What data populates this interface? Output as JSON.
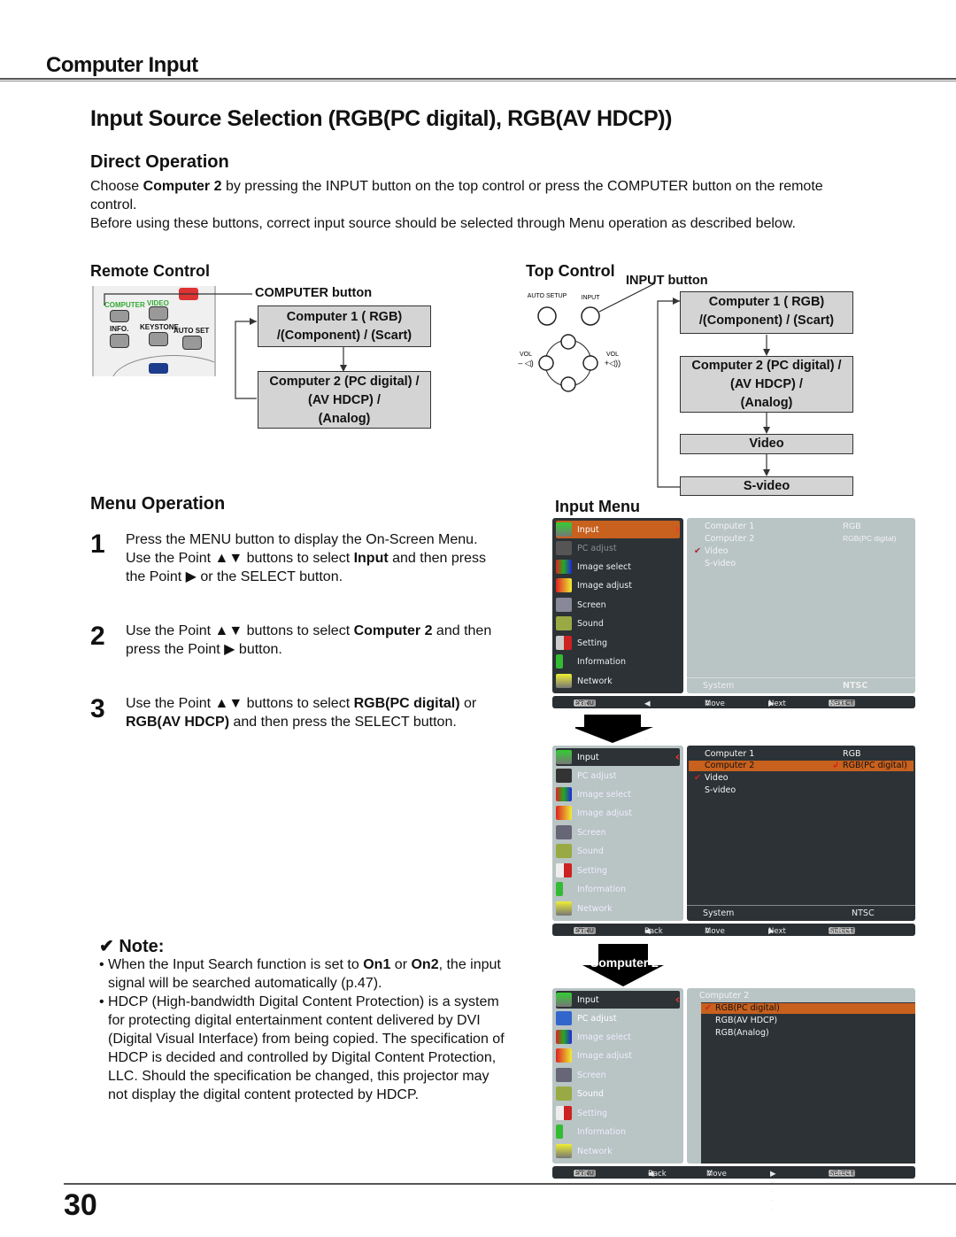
{
  "section_title": "Computer Input",
  "page_title": "Input Source Selection (RGB(PC digital), RGB(AV HDCP))",
  "direct_operation": {
    "heading": "Direct Operation",
    "p1_pre": "Choose ",
    "p1_bold": "Computer 2",
    "p1_post": " by pressing the INPUT button on the top control or press the COMPUTER button on the remote control.",
    "p2": "Before using these buttons, correct input source should be selected through Menu operation as described below."
  },
  "remote_control": {
    "heading": "Remote Control",
    "callout": "COMPUTER button",
    "remote_labels": {
      "computer": "COMPUTER",
      "video": "VIDEO",
      "info": "INFO.",
      "keystone": "KEYSTONE",
      "auto_set": "AUTO SET"
    },
    "flow": [
      [
        "Computer 1 ( RGB)",
        "/(Component) / (Scart)"
      ],
      [
        "Computer 2 (PC digital) /",
        "(AV HDCP) /",
        "(Analog)"
      ]
    ]
  },
  "top_control": {
    "heading": "Top Control",
    "callout": "INPUT button",
    "panel_labels": {
      "auto_setup": "AUTO SETUP",
      "input": "INPUT",
      "vol_minus": "VOL",
      "vol_plus": "VOL"
    },
    "flow": [
      [
        "Computer 1 ( RGB)",
        "/(Component) / (Scart)"
      ],
      [
        "Computer 2 (PC digital) /",
        "(AV HDCP) /",
        "(Analog)"
      ],
      [
        "Video"
      ],
      [
        "S-video"
      ]
    ]
  },
  "menu_operation": {
    "heading": "Menu Operation",
    "steps": [
      {
        "num": "1",
        "a": "Press the MENU button to display the On-Screen Menu. Use the Point ▲▼ buttons to select ",
        "b": "Input",
        "c": " and then press the Point ▶ or the SELECT button."
      },
      {
        "num": "2",
        "a": "Use the Point ▲▼ buttons to select ",
        "b": "Computer 2",
        "c": " and then press the Point ▶ button."
      },
      {
        "num": "3",
        "a": "Use the Point ▲▼ buttons to select ",
        "b": "RGB(PC digital)",
        "c": " or ",
        "d": "RGB(AV HDCP)",
        "e": " and then press the SELECT button."
      }
    ]
  },
  "note": {
    "heading": "✔ Note:",
    "items": [
      {
        "a": "When the Input Search function is set to ",
        "b": "On1",
        "c": " or ",
        "d": "On2",
        "e": ", the input signal will be searched automatically (p.47)."
      },
      {
        "a": "HDCP (High-bandwidth Digital Content Protection) is a system for protecting digital entertainment content delivered by DVI (Digital Visual Interface) from being copied. The specification of HDCP is decided and controlled by Digital Content Protection, LLC. Should the specification be changed, this projector may not display the digital content protected by HDCP."
      }
    ]
  },
  "input_menu": {
    "heading": "Input Menu",
    "menu_items": [
      "Input",
      "PC adjust",
      "Image select",
      "Image adjust",
      "Screen",
      "Sound",
      "Setting",
      "Information",
      "Network"
    ],
    "screen1": {
      "rows": [
        {
          "label": "Computer 1",
          "value": "RGB"
        },
        {
          "label": "Computer 2",
          "value": "RGB(PC digital)"
        },
        {
          "label": "Video",
          "value": "",
          "checked": true
        },
        {
          "label": "S-video",
          "value": ""
        }
      ],
      "system_label": "System",
      "system_value": "NTSC",
      "bar": [
        "Exit",
        "-----",
        "Move",
        "Next",
        "Next"
      ]
    },
    "screen2": {
      "rows": [
        {
          "label": "Computer 1",
          "value": "RGB"
        },
        {
          "label": "Computer 2",
          "value": "RGB(PC digital)",
          "selected": true
        },
        {
          "label": "Video",
          "value": "",
          "checked": true
        },
        {
          "label": "S-video",
          "value": ""
        }
      ],
      "system_label": "System",
      "system_value": "NTSC",
      "bar": [
        "Exit",
        "Back",
        "Move",
        "Next",
        "Select"
      ]
    },
    "arrow2_label": "Computer 2",
    "screen3": {
      "title": "Computer 2",
      "rows": [
        "RGB(PC digital)",
        "RGB(AV HDCP)",
        "RGB(Analog)"
      ],
      "bar": [
        "Exit",
        "Back",
        "Move",
        "-----",
        "Select"
      ]
    },
    "key_menu": "MENU",
    "key_select": "SELECT"
  },
  "page_number": "30",
  "colors": {
    "orange": "#c8601e",
    "osd_dark": "#2c3236",
    "osd_light": "#b9c4c4"
  }
}
